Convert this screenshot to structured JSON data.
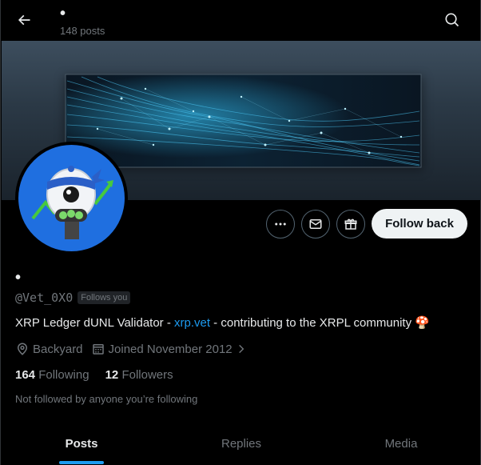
{
  "header": {
    "display_name": "•",
    "post_count": "148 posts"
  },
  "profile": {
    "display_name": "•",
    "handle": "@Vet_0X0",
    "follows_you_badge": "Follows you",
    "bio_prefix": "XRP Ledger dUNL Validator - ",
    "bio_link": "xrp.vet",
    "bio_suffix": " - contributing to the XRPL community 🍄",
    "location": "Backyard",
    "joined": "Joined November 2012",
    "following_count": "164",
    "following_label": "Following",
    "followers_count": "12",
    "followers_label": "Followers",
    "not_followed_text": "Not followed by anyone you’re following"
  },
  "actions": {
    "more_icon": "more-dots-icon",
    "message_icon": "envelope-icon",
    "subscribe_icon": "gift-icon",
    "follow_back_label": "Follow back"
  },
  "tabs": [
    {
      "label": "Posts",
      "active": true
    },
    {
      "label": "Replies",
      "active": false
    },
    {
      "label": "Media",
      "active": false
    }
  ],
  "colors": {
    "accent": "#1d9bf0",
    "background": "#000000",
    "text_primary": "#e7e9ea",
    "text_secondary": "#71767b"
  }
}
